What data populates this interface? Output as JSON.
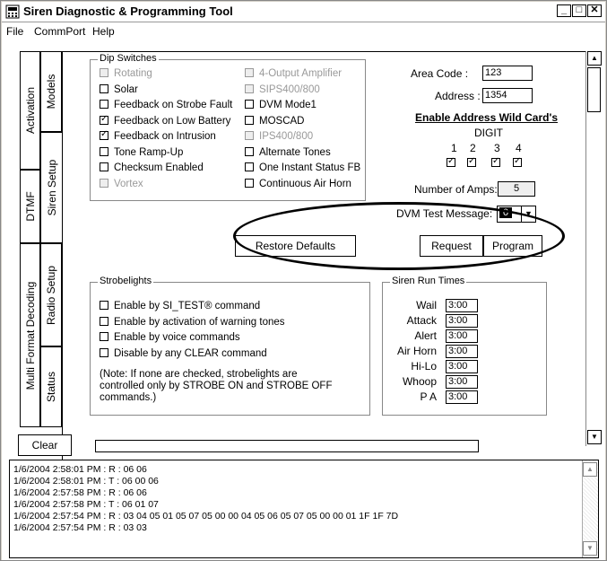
{
  "window": {
    "title": "Siren Diagnostic & Programming Tool"
  },
  "menu": [
    "File",
    "CommPort",
    "Help"
  ],
  "tabs": {
    "left": [
      "Activation",
      "DTMF",
      "Multi Format Decoding"
    ],
    "right": [
      "Models",
      "Siren Setup",
      "Radio Setup",
      "Status"
    ]
  },
  "dip": {
    "label": "Dip Switches",
    "col1": [
      {
        "label": "Rotating",
        "checked": false,
        "disabled": true
      },
      {
        "label": "Solar",
        "checked": false,
        "disabled": false
      },
      {
        "label": "Feedback on Strobe Fault",
        "checked": false,
        "disabled": false
      },
      {
        "label": "Feedback on Low Battery",
        "checked": true,
        "disabled": false
      },
      {
        "label": "Feedback on Intrusion",
        "checked": true,
        "disabled": false
      },
      {
        "label": "Tone Ramp-Up",
        "checked": false,
        "disabled": false
      },
      {
        "label": "Checksum Enabled",
        "checked": false,
        "disabled": false
      },
      {
        "label": "Vortex",
        "checked": false,
        "disabled": true
      }
    ],
    "col2": [
      {
        "label": "4-Output Amplifier",
        "checked": false,
        "disabled": true
      },
      {
        "label": "SIPS400/800",
        "checked": false,
        "disabled": true
      },
      {
        "label": "DVM Mode1",
        "checked": false,
        "disabled": false
      },
      {
        "label": "MOSCAD",
        "checked": false,
        "disabled": false
      },
      {
        "label": "IPS400/800",
        "checked": false,
        "disabled": true
      },
      {
        "label": "Alternate Tones",
        "checked": false,
        "disabled": false
      },
      {
        "label": "One Instant Status FB",
        "checked": false,
        "disabled": false
      },
      {
        "label": "Continuous Air Horn",
        "checked": false,
        "disabled": false
      }
    ]
  },
  "address": {
    "area_code_label": "Area Code :",
    "area_code_value": "123",
    "address_label": "Address :",
    "address_value": "1354",
    "wildcard_title": "Enable Address Wild Card's",
    "digit_label": "DIGIT",
    "digits": [
      "1",
      "2",
      "3",
      "4"
    ],
    "num_amps_label": "Number of Amps:",
    "num_amps_value": "5",
    "dvm_label": "DVM Test Message:",
    "dvm_value": "0"
  },
  "buttons": {
    "restore": "Restore Defaults",
    "request": "Request",
    "program": "Program",
    "clear": "Clear"
  },
  "strobe": {
    "label": "Strobelights",
    "items": [
      "Enable by SI_TEST® command",
      "Enable by activation of warning tones",
      "Enable by voice commands",
      "Disable by any CLEAR command"
    ],
    "note": [
      "(Note: If none are checked, strobelights are",
      "controlled only by STROBE ON and STROBE OFF",
      "commands.)"
    ]
  },
  "runtimes": {
    "label": "Siren Run Times",
    "rows": [
      {
        "name": "Wail",
        "value": "3:00"
      },
      {
        "name": "Attack",
        "value": "3:00"
      },
      {
        "name": "Alert",
        "value": "3:00"
      },
      {
        "name": "Air Horn",
        "value": "3:00"
      },
      {
        "name": "Hi-Lo",
        "value": "3:00"
      },
      {
        "name": "Whoop",
        "value": "3:00"
      },
      {
        "name": "P A",
        "value": "3:00"
      }
    ]
  },
  "log": [
    "1/6/2004 2:58:01 PM : R : 06 06",
    "1/6/2004 2:58:01 PM : T : 06 00 06",
    "1/6/2004 2:57:58 PM : R : 06 06",
    "1/6/2004 2:57:58 PM : T : 06 01 07",
    "1/6/2004 2:57:54 PM : R : 03 04 05 01 05 07 05 00 00 04 05 06 05 07 05 00 00 01 1F 1F 7D",
    "1/6/2004 2:57:54 PM : R : 03 03"
  ]
}
